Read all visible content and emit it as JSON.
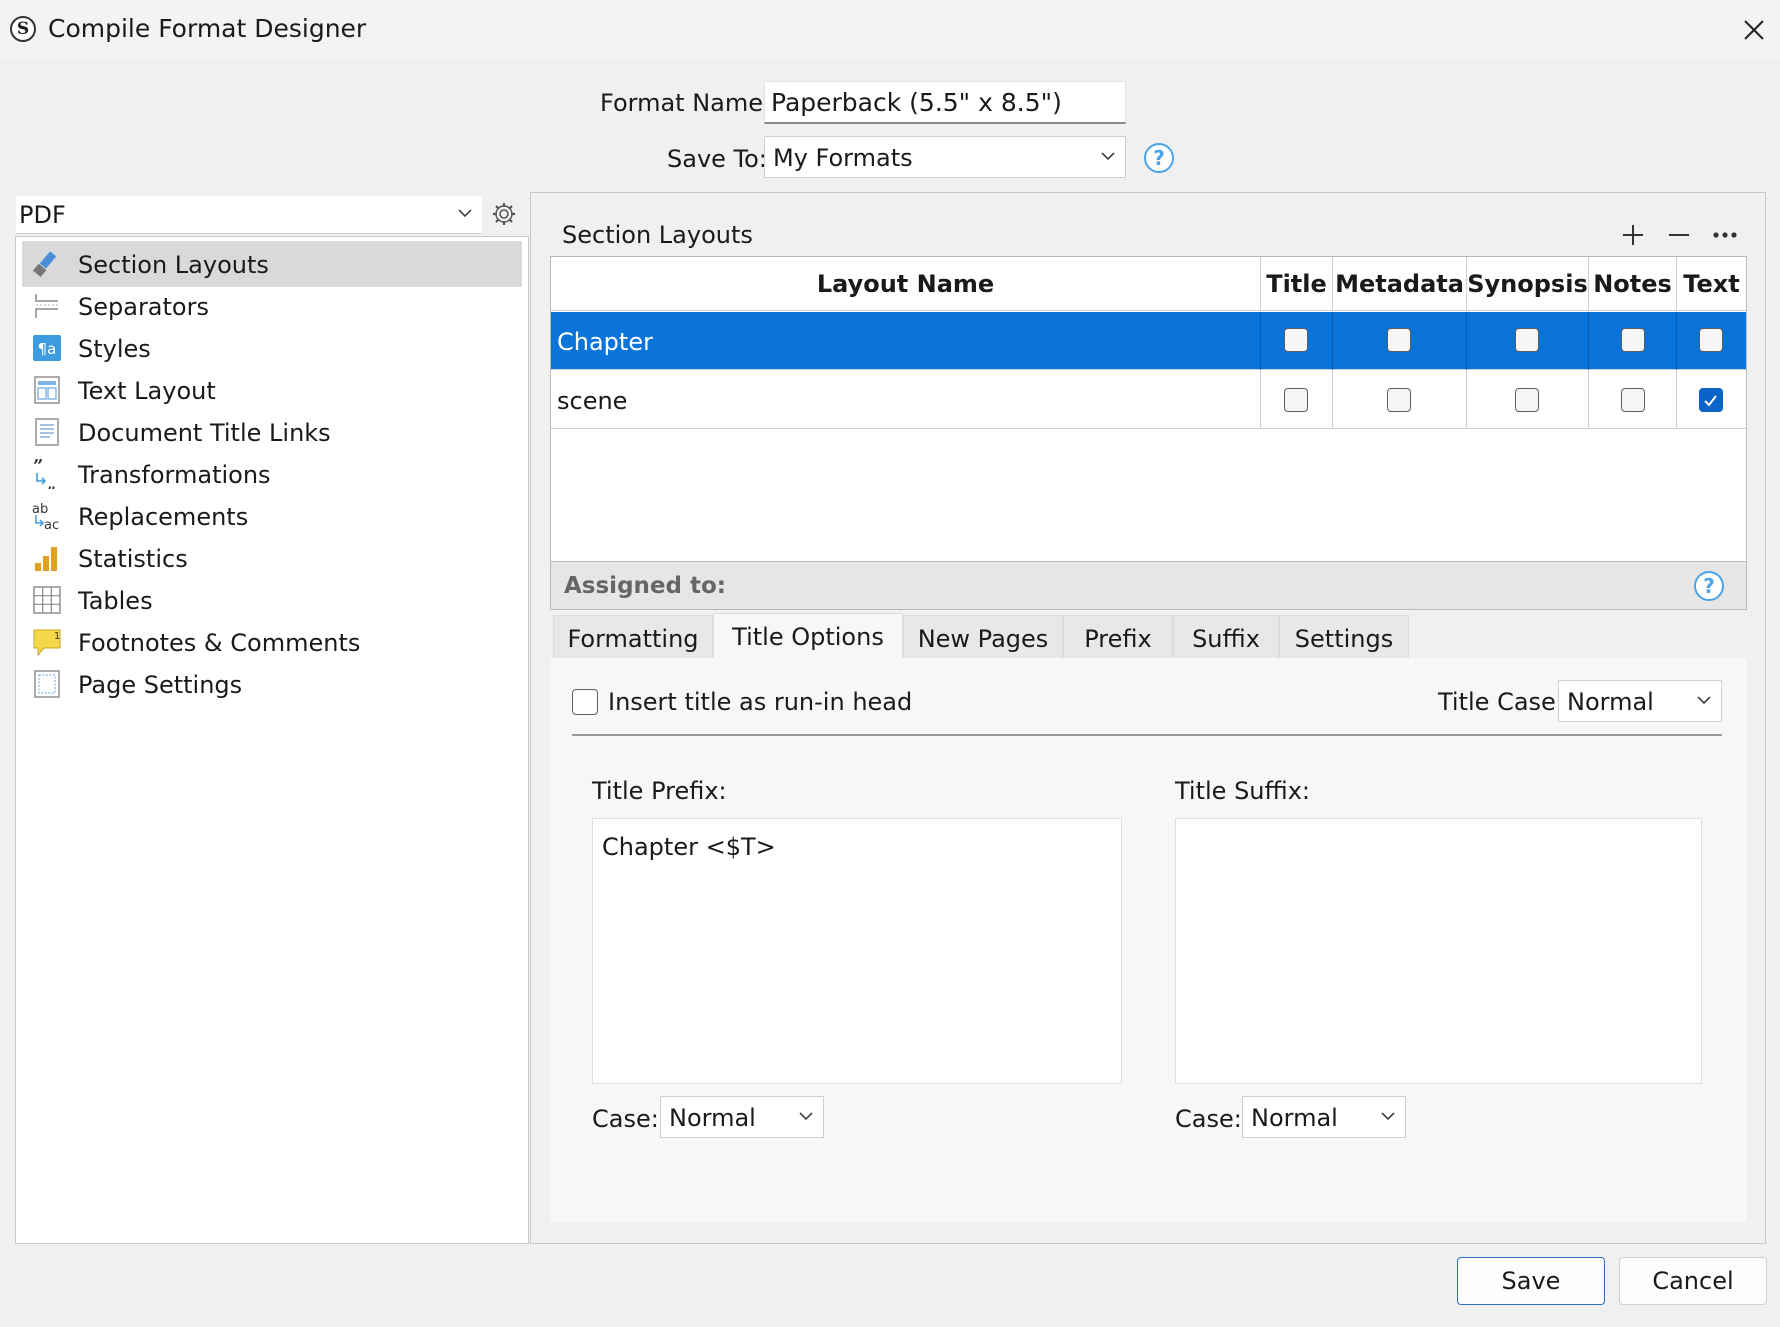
{
  "window": {
    "title": "Compile Format Designer"
  },
  "header": {
    "format_name_label": "Format Name:",
    "format_name_value": "Paperback (5.5\" x 8.5\")",
    "save_to_label": "Save To:",
    "save_to_value": "My Formats"
  },
  "sidebar": {
    "format_value": "PDF",
    "items": [
      {
        "label": "Section Layouts",
        "icon": "brush-icon",
        "selected": true
      },
      {
        "label": "Separators",
        "icon": "separators-icon"
      },
      {
        "label": "Styles",
        "icon": "styles-icon"
      },
      {
        "label": "Text Layout",
        "icon": "text-layout-icon"
      },
      {
        "label": "Document Title Links",
        "icon": "document-icon"
      },
      {
        "label": "Transformations",
        "icon": "quotes-icon"
      },
      {
        "label": "Replacements",
        "icon": "replace-icon"
      },
      {
        "label": "Statistics",
        "icon": "bar-chart-icon"
      },
      {
        "label": "Tables",
        "icon": "table-icon"
      },
      {
        "label": "Footnotes & Comments",
        "icon": "footnote-icon"
      },
      {
        "label": "Page Settings",
        "icon": "page-icon"
      }
    ]
  },
  "section_layouts": {
    "title": "Section Layouts",
    "columns": [
      "Layout Name",
      "Title",
      "Metadata",
      "Synopsis",
      "Notes",
      "Text"
    ],
    "rows": [
      {
        "name": "Chapter",
        "selected": true,
        "checks": [
          false,
          false,
          false,
          false,
          false
        ]
      },
      {
        "name": "scene",
        "selected": false,
        "checks": [
          false,
          false,
          false,
          false,
          true
        ]
      }
    ],
    "assigned_label": "Assigned to:"
  },
  "tabs": [
    "Formatting",
    "Title Options",
    "New Pages",
    "Prefix",
    "Suffix",
    "Settings"
  ],
  "active_tab": "Title Options",
  "title_options": {
    "runin_label": "Insert title as run-in head",
    "runin_checked": false,
    "title_case_label": "Title Case:",
    "title_case_value": "Normal",
    "prefix_label": "Title Prefix:",
    "prefix_text": "Chapter <$T>",
    "suffix_label": "Title Suffix:",
    "suffix_text": "",
    "case_label": "Case:",
    "prefix_case_value": "Normal",
    "suffix_case_value": "Normal"
  },
  "buttons": {
    "save": "Save",
    "cancel": "Cancel"
  },
  "colors": {
    "selection": "#0a74da",
    "checkbox_on": "#0a63c9",
    "help_blue": "#4aa3e8"
  }
}
